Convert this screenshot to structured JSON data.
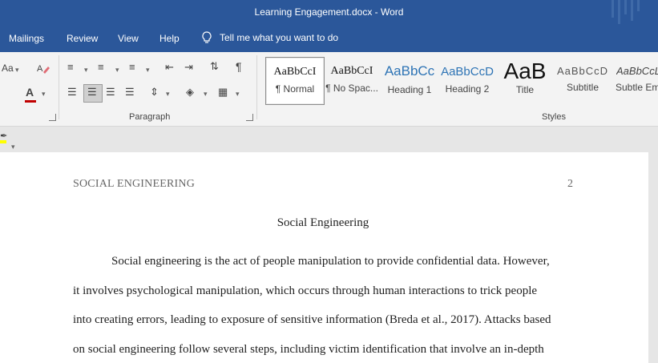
{
  "window": {
    "title": "Learning Engagement.docx  -  Word"
  },
  "menu": {
    "tabs": [
      {
        "label": "Mailings"
      },
      {
        "label": "Review"
      },
      {
        "label": "View"
      },
      {
        "label": "Help"
      }
    ],
    "tell_me": "Tell me what you want to do"
  },
  "ribbon": {
    "font_group": {
      "change_case": "Aa"
    },
    "paragraph_group": {
      "label": "Paragraph"
    },
    "styles_group": {
      "label": "Styles",
      "styles": [
        {
          "sample": "AaBbCcI",
          "name": "¶ Normal",
          "selected": true
        },
        {
          "sample": "AaBbCcI",
          "name": "¶ No Spac...",
          "selected": false
        },
        {
          "sample": "AaBbCc",
          "name": "Heading 1",
          "selected": false
        },
        {
          "sample": "AaBbCcD",
          "name": "Heading 2",
          "selected": false
        },
        {
          "sample": "AaB",
          "name": "Title",
          "selected": false
        },
        {
          "sample": "AaBbCcD",
          "name": "Subtitle",
          "selected": false
        },
        {
          "sample": "AaBbCcL",
          "name": "Subtle Em",
          "selected": false
        }
      ]
    },
    "colors": {
      "highlight": "#ffff00",
      "font_color": "#c00000",
      "accent": "#2b579a"
    }
  },
  "document": {
    "header_left": "SOCIAL ENGINEERING",
    "page_number": "2",
    "title": "Social Engineering",
    "lines": [
      "Social engineering is the act of people manipulation to provide confidential data. However,",
      "it involves psychological manipulation, which occurs through human interactions to trick people",
      "into creating errors, leading to exposure of sensitive information (Breda et al., 2017). Attacks based",
      "on social engineering follow several steps, including victim identification that involve an in-depth"
    ]
  }
}
